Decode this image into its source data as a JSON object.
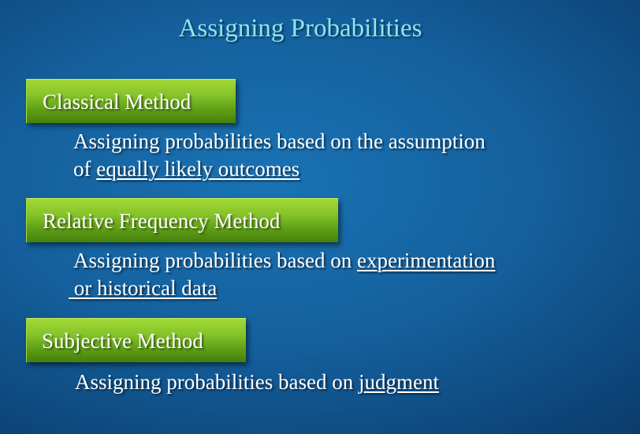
{
  "slide": {
    "title": "Assigning Probabilities",
    "methods": [
      {
        "label": "Classical Method",
        "description_plain_1": "Assigning probabilities based on the assumption",
        "description_plain_2": "of ",
        "description_underlined_2": "equally likely outcomes"
      },
      {
        "label": "Relative Frequency Method",
        "description_plain_1": "Assigning probabilities based on ",
        "description_underlined_1": "experimentation",
        "description_underlined_2": " or historical data"
      },
      {
        "label": "Subjective Method",
        "description_plain_1": "Assigning probabilities based on ",
        "description_underlined_1": "judgment"
      }
    ]
  }
}
